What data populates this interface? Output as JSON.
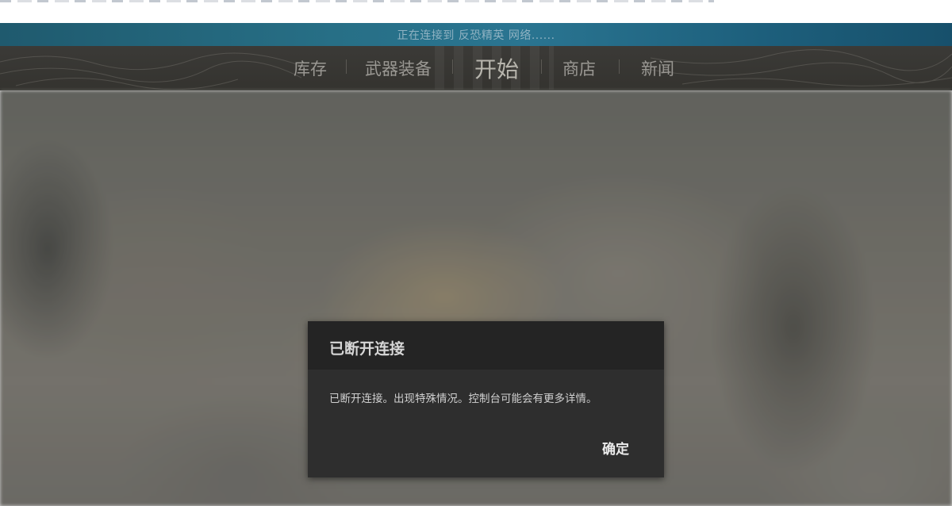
{
  "status_bar": {
    "text": "正在连接到 反恐精英 网络......"
  },
  "nav": {
    "items": [
      {
        "label": "库存"
      },
      {
        "label": "武器装备"
      },
      {
        "label": "开始"
      },
      {
        "label": "商店"
      },
      {
        "label": "新闻"
      }
    ],
    "active_label": "开始"
  },
  "dialog": {
    "title": "已断开连接",
    "message": "已断开连接。出现特殊情况。控制台可能会有更多详情。",
    "ok_label": "确定"
  },
  "colors": {
    "status_bar": "#276f86",
    "nav_bar": "#38372f",
    "dialog_bg": "#2e2e2e",
    "dialog_header": "#242424"
  }
}
